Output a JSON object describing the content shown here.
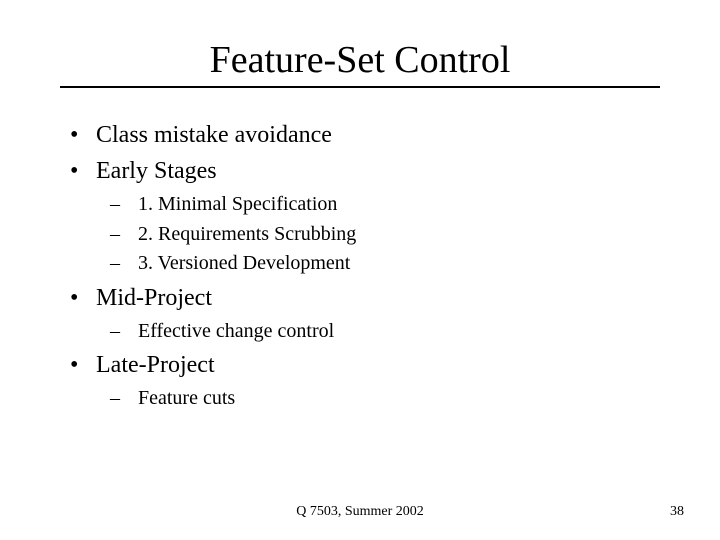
{
  "slide": {
    "title": "Feature-Set Control",
    "bullets": {
      "b0": "Class mistake avoidance",
      "b1": "Early Stages",
      "b1_sub": {
        "s0": "1. Minimal Specification",
        "s1": "2. Requirements Scrubbing",
        "s2": "3. Versioned Development"
      },
      "b2": "Mid-Project",
      "b2_sub": {
        "s0": "Effective change control"
      },
      "b3": "Late-Project",
      "b3_sub": {
        "s0": "Feature cuts"
      }
    },
    "footer": {
      "center": "Q 7503, Summer 2002",
      "page": "38"
    }
  }
}
